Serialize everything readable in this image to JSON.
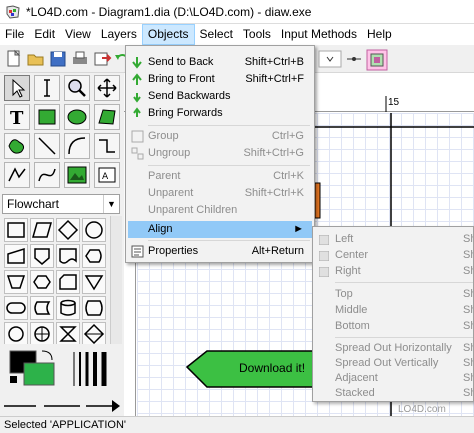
{
  "window": {
    "title": "*LO4D.com - Diagram1.dia (D:\\LO4D.com) - diaw.exe"
  },
  "menubar": {
    "items": [
      {
        "label": "File"
      },
      {
        "label": "Edit"
      },
      {
        "label": "View"
      },
      {
        "label": "Layers"
      },
      {
        "label": "Objects"
      },
      {
        "label": "Select"
      },
      {
        "label": "Tools"
      },
      {
        "label": "Input Methods"
      },
      {
        "label": "Help"
      }
    ]
  },
  "sheet_selector": {
    "value": "Flowchart"
  },
  "ruler": {
    "mark_label": "15"
  },
  "objects_menu": {
    "items": [
      {
        "label": "Send to Back",
        "shortcut": "Shift+Ctrl+B"
      },
      {
        "label": "Bring to Front",
        "shortcut": "Shift+Ctrl+F"
      },
      {
        "label": "Send Backwards",
        "shortcut": ""
      },
      {
        "label": "Bring Forwards",
        "shortcut": ""
      },
      {
        "label": "Group",
        "shortcut": "Ctrl+G"
      },
      {
        "label": "Ungroup",
        "shortcut": "Shift+Ctrl+G"
      },
      {
        "label": "Parent",
        "shortcut": "Ctrl+K"
      },
      {
        "label": "Unparent",
        "shortcut": "Shift+Ctrl+K"
      },
      {
        "label": "Unparent Children",
        "shortcut": ""
      },
      {
        "label": "Align",
        "shortcut": ""
      },
      {
        "label": "Properties",
        "shortcut": "Alt+Return"
      }
    ]
  },
  "align_submenu": {
    "items": [
      {
        "label": "Left",
        "shortcut": "Sh"
      },
      {
        "label": "Center",
        "shortcut": "Sh"
      },
      {
        "label": "Right",
        "shortcut": "Sh"
      },
      {
        "label": "Top",
        "shortcut": "Sh"
      },
      {
        "label": "Middle",
        "shortcut": "Shi"
      },
      {
        "label": "Bottom",
        "shortcut": "Sh"
      },
      {
        "label": "Spread Out Horizontally",
        "shortcut": "Sh"
      },
      {
        "label": "Spread Out Vertically",
        "shortcut": "Sh"
      },
      {
        "label": "Adjacent",
        "shortcut": "Sh"
      },
      {
        "label": "Stacked",
        "shortcut": "Sh"
      }
    ]
  },
  "canvas": {
    "shape_label": "Download it!"
  },
  "statusbar": {
    "text": "Selected 'APPLICATION'"
  },
  "watermark": {
    "text": "LO4D.com"
  },
  "colors": {
    "menu_highlight": "#91c9f7",
    "active_menu": "#cce8ff",
    "shape_green": "#3cc043",
    "shape_yellow": "#ffff00",
    "fill_green": "#2db24a"
  }
}
